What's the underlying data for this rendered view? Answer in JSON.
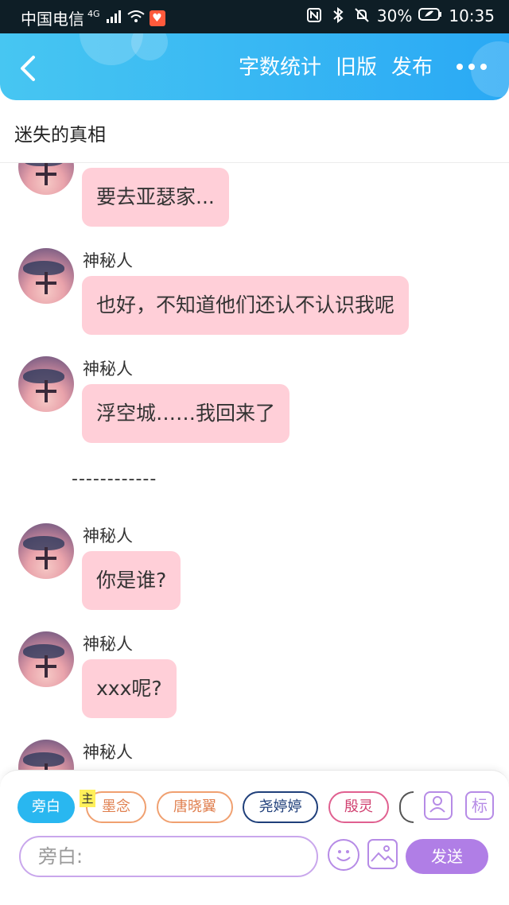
{
  "status_bar": {
    "carrier": "中国电信",
    "network": "4G",
    "battery": "30%",
    "time": "10:35"
  },
  "header": {
    "actions": [
      "字数统计",
      "旧版",
      "发布"
    ]
  },
  "document": {
    "title": "迷失的真相"
  },
  "chat": {
    "messages": [
      {
        "sender": "",
        "text": "要去亚瑟家..."
      },
      {
        "sender": "神秘人",
        "text": "也好，不知道他们还认不认识我呢"
      },
      {
        "sender": "神秘人",
        "text": "浮空城……我回来了"
      },
      {
        "separator": "------------"
      },
      {
        "sender": "神秘人",
        "text": "你是谁?"
      },
      {
        "sender": "神秘人",
        "text": "xxx呢?"
      },
      {
        "sender": "神秘人",
        "text": ""
      }
    ]
  },
  "composer": {
    "roles": [
      "旁白",
      "墨念",
      "唐晓翼",
      "尧婷婷",
      "殷灵"
    ],
    "main_tag": "主",
    "tag_button": "标",
    "input_placeholder": "旁白:",
    "send_label": "发送",
    "colors": {
      "narration": "#29b7f0",
      "role_mo_nian": "#f0a070",
      "role_tang_xiao_yi": "#f0a070",
      "role_yao_ting_ting": "#1f3f7a",
      "role_yin_ling": "#e06090",
      "accent": "#b07ee6"
    }
  }
}
